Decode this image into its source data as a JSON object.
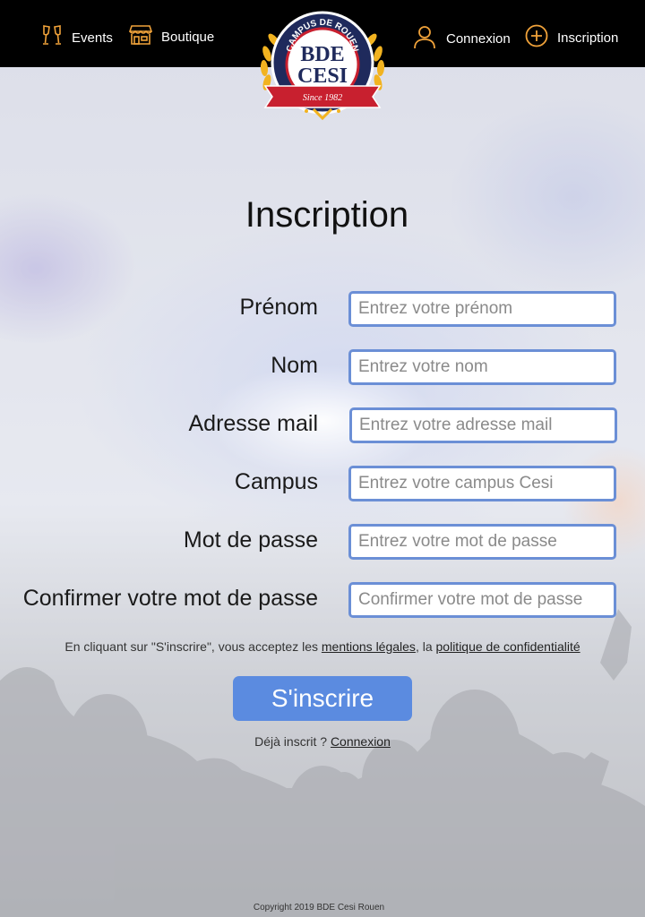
{
  "nav": {
    "events_label": "Events",
    "boutique_label": "Boutique",
    "connexion_label": "Connexion",
    "inscription_label": "Inscription"
  },
  "logo": {
    "arc_text": "CAMPUS DE ROUEN",
    "line1": "BDE",
    "line2": "CESI",
    "ribbon": "Since 1982"
  },
  "form": {
    "title": "Inscription",
    "fields": [
      {
        "label": "Prénom",
        "placeholder": "Entrez votre prénom"
      },
      {
        "label": "Nom",
        "placeholder": "Entrez votre nom"
      },
      {
        "label": "Adresse mail",
        "placeholder": "Entrez votre adresse mail"
      },
      {
        "label": "Campus",
        "placeholder": "Entrez votre campus Cesi"
      },
      {
        "label": "Mot de passe",
        "placeholder": "Entrez votre mot de passe"
      },
      {
        "label": "Confirmer votre mot de passe",
        "placeholder": "Confirmer votre mot de passe"
      }
    ],
    "terms_prefix": "En cliquant sur \"S'inscrire\", vous acceptez les ",
    "terms_link1": "mentions légales",
    "terms_middle": ", la ",
    "terms_link2": "politique de confidentialité",
    "submit_label": "S'inscrire",
    "already_prefix": "Déjà inscrit ? ",
    "already_link": "Connexion"
  },
  "footer": {
    "copyright": "Copyright 2019 BDE Cesi Rouen"
  },
  "colors": {
    "accent_blue": "#5b8be0",
    "input_border": "#6b8fd6",
    "nav_bg": "#000000",
    "icon_orange": "#f0a23a",
    "logo_navy": "#1f2a5c",
    "logo_red": "#c8202f",
    "logo_gold": "#f2b320"
  },
  "icons": {
    "events": "champagne-glasses-icon",
    "boutique": "shop-icon",
    "connexion": "user-icon",
    "inscription": "plus-circle-icon"
  }
}
